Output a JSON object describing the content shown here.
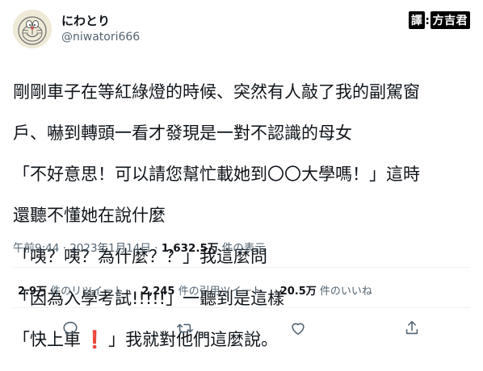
{
  "user": {
    "display_name": "にわとり",
    "handle": "@niwatori666",
    "avatar_icon": "doraemon-avatar-icon"
  },
  "translator": {
    "tag": "譯",
    "name": "方吉君"
  },
  "tweet": {
    "lines": [
      "剛剛車子在等紅綠燈的時候、突然有人敲了我的副駕窗",
      "戶、嚇到轉頭一看才發現是一對不認識的母女",
      "「不好意思！可以請您幫忙載她到〇〇大學嗎！」這時",
      "還聽不懂她在說什麼",
      "「咦？咦？為什麼？？」我這麼問",
      "「因為入學考試!!!!!」一聽到是這樣",
      "「快上車",
      "」我就對他們這麼說。"
    ],
    "emoji": "❗"
  },
  "meta": {
    "time": "午前9:44 · 2023年1月14日 · ",
    "views": "1,632.5万",
    "views_label": " 件の表示"
  },
  "stats": [
    {
      "num": "2.9万",
      "label": " 件のリツイート"
    },
    {
      "num": "2,245",
      "label": " 件の引用ツイート"
    },
    {
      "num": "20.5万",
      "label": " 件のいいね"
    }
  ],
  "colors": {
    "text": "#0f1419",
    "secondary": "#536471",
    "divider": "#eff3f4",
    "emoji_red": "#dd2e44"
  }
}
